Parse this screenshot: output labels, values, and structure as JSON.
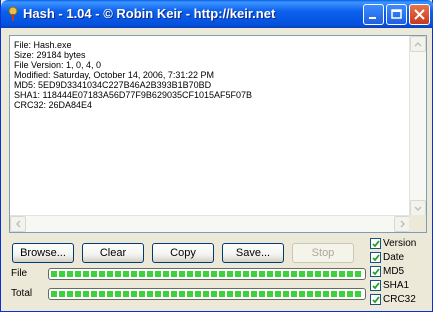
{
  "window": {
    "title": "Hash - 1.04 - © Robin Keir - http://keir.net",
    "icons": {
      "app": "hash-app-icon",
      "minimize": "minimize-icon",
      "maximize": "maximize-icon",
      "close": "close-icon"
    }
  },
  "output": {
    "lines": [
      "File: Hash.exe",
      "Size: 29184 bytes",
      "File Version: 1, 0, 4, 0",
      "Modified: Saturday, October 14, 2006, 7:31:22 PM",
      "MD5: 5ED9D3341034C227B46A2B393B1B70BD",
      "SHA1: 118444E07183A56D77F9B629035CF1015AF5F07B",
      "CRC32: 26DA84E4"
    ]
  },
  "buttons": {
    "browse": "Browse...",
    "clear": "Clear",
    "copy": "Copy",
    "save": "Save...",
    "stop": "Stop"
  },
  "progress": {
    "file_label": "File",
    "total_label": "Total",
    "file_value": 1.0,
    "total_value": 1.0,
    "color": "#3bd13b"
  },
  "options": {
    "version": "Version",
    "date": "Date",
    "md5": "MD5",
    "sha1": "SHA1",
    "crc32": "CRC32"
  },
  "colors": {
    "titlebar": "#0b61ec",
    "close": "#c8391c",
    "progress": "#3bd13b"
  }
}
